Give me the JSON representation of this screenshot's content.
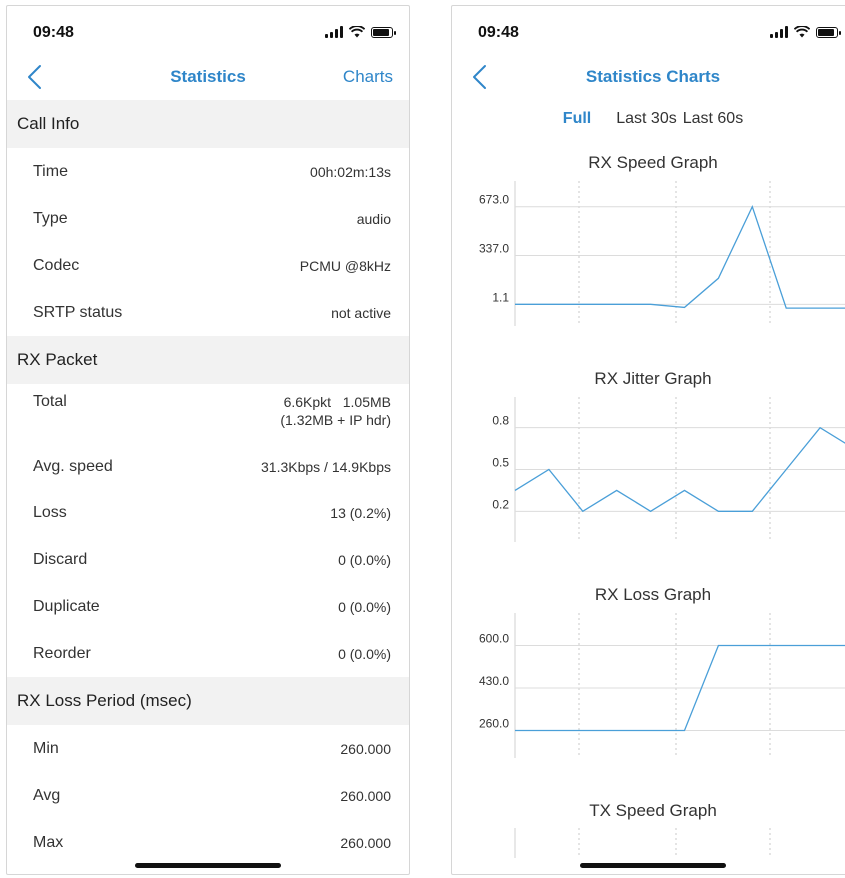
{
  "left": {
    "status_time": "09:48",
    "nav": {
      "title": "Statistics",
      "right": "Charts"
    },
    "sections": [
      {
        "header": "Call Info",
        "rows": [
          {
            "label": "Time",
            "value": "00h:02m:13s"
          },
          {
            "label": "Type",
            "value": "audio"
          },
          {
            "label": "Codec",
            "value": "PCMU @8kHz"
          },
          {
            "label": "SRTP status",
            "value": "not active"
          }
        ]
      },
      {
        "header": "RX Packet",
        "rows": [
          {
            "label": "Total",
            "value": "6.6Kpkt   1.05MB",
            "value2": "(1.32MB + IP hdr)"
          },
          {
            "label": "Avg. speed",
            "value": "31.3Kbps / 14.9Kbps"
          },
          {
            "label": "Loss",
            "value": "13 (0.2%)"
          },
          {
            "label": "Discard",
            "value": "0 (0.0%)"
          },
          {
            "label": "Duplicate",
            "value": "0 (0.0%)"
          },
          {
            "label": "Reorder",
            "value": "0 (0.0%)"
          }
        ]
      },
      {
        "header": "RX Loss Period (msec)",
        "rows": [
          {
            "label": "Min",
            "value": "260.000"
          },
          {
            "label": "Avg",
            "value": "260.000"
          },
          {
            "label": "Max",
            "value": "260.000"
          }
        ]
      }
    ]
  },
  "right": {
    "status_time": "09:48",
    "nav": {
      "title": "Statistics Charts"
    },
    "segments": [
      "Full",
      "Last 30s",
      "Last 60s"
    ],
    "selected_segment": "Full"
  },
  "colors": {
    "accent": "#2f86c9",
    "line": "#4a9fd8",
    "section_bg": "#f2f2f2"
  },
  "chart_data": [
    {
      "type": "line",
      "title": "RX Speed Graph",
      "ytick_labels": [
        "673.0",
        "337.0",
        "1.1"
      ],
      "ytick_values": [
        673.0,
        337.0,
        1.1
      ],
      "ylim": [
        -148,
        850
      ],
      "x": [
        0,
        1,
        2,
        3,
        4,
        5,
        6,
        7,
        8,
        9,
        10
      ],
      "values": [
        1.1,
        1.1,
        1.1,
        1.1,
        1.1,
        -20,
        180,
        673,
        -25,
        -25,
        -25
      ],
      "grid": true
    },
    {
      "type": "line",
      "title": "RX Jitter Graph",
      "ytick_labels": [
        "0.8",
        "0.5",
        "0.2"
      ],
      "ytick_values": [
        0.8,
        0.5,
        0.2
      ],
      "ylim": [
        -0.02,
        1.02
      ],
      "x": [
        0,
        1,
        2,
        3,
        4,
        5,
        6,
        7,
        8,
        9,
        10
      ],
      "values": [
        0.35,
        0.5,
        0.2,
        0.35,
        0.2,
        0.35,
        0.2,
        0.2,
        0.5,
        0.8,
        0.65
      ],
      "grid": true
    },
    {
      "type": "line",
      "title": "RX Loss Graph",
      "ytick_labels": [
        "600.0",
        "430.0",
        "260.0"
      ],
      "ytick_values": [
        600,
        430,
        260
      ],
      "ylim": [
        150,
        730
      ],
      "x": [
        0,
        1,
        2,
        3,
        4,
        5,
        6,
        7,
        8,
        9,
        10
      ],
      "values": [
        260,
        260,
        260,
        260,
        260,
        260,
        600,
        600,
        600,
        600,
        600
      ],
      "grid": true
    },
    {
      "type": "line",
      "title": "TX Speed Graph",
      "values": [],
      "grid": true
    }
  ]
}
